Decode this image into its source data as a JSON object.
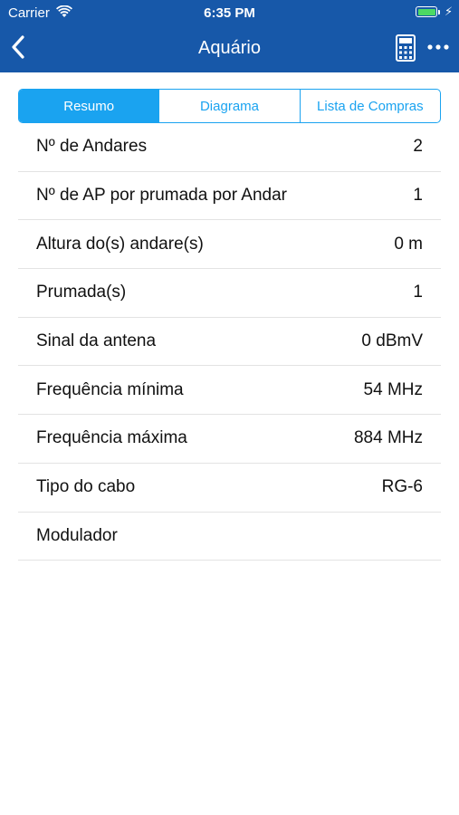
{
  "status_bar": {
    "carrier": "Carrier",
    "time": "6:35 PM",
    "battery_color": "#4cd964",
    "icons": [
      "wifi-icon",
      "battery-icon",
      "charging-bolt-icon"
    ]
  },
  "nav": {
    "title": "Aquário",
    "background": "#1758a9",
    "icons": [
      "back-chevron-icon",
      "calculator-icon",
      "more-icon"
    ]
  },
  "tabs": {
    "accent": "#1aa3f0",
    "items": [
      {
        "label": "Resumo",
        "selected": true
      },
      {
        "label": "Diagrama",
        "selected": false
      },
      {
        "label": "Lista de Compras",
        "selected": false
      }
    ]
  },
  "rows": [
    {
      "label": "Nº de Andares",
      "value": "2"
    },
    {
      "label": "Nº de AP por prumada por Andar",
      "value": "1"
    },
    {
      "label": "Altura do(s) andare(s)",
      "value": "0 m"
    },
    {
      "label": "Prumada(s)",
      "value": "1"
    },
    {
      "label": "Sinal da antena",
      "value": "0 dBmV"
    },
    {
      "label": "Frequência mínima",
      "value": "54 MHz"
    },
    {
      "label": "Frequência máxima",
      "value": "884 MHz"
    },
    {
      "label": "Tipo do cabo",
      "value": "RG-6"
    },
    {
      "label": "Modulador",
      "value": ""
    }
  ]
}
